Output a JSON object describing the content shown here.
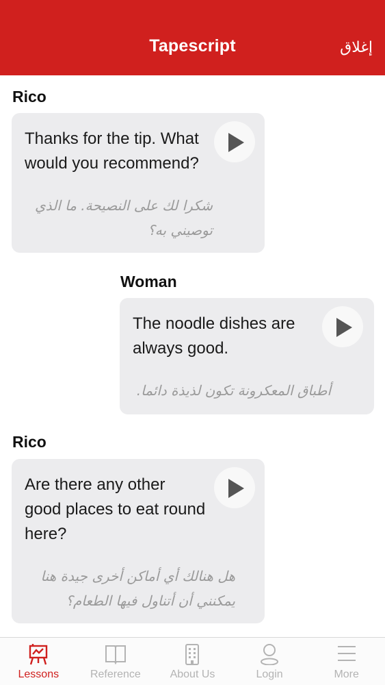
{
  "header": {
    "title": "Tapescript",
    "close_label": "إغلاق"
  },
  "dialogue": [
    {
      "speaker": "Rico",
      "en_lines": [
        "Thanks for the tip. What",
        "would you recommend?"
      ],
      "ar_lines": [
        "شكرا لك على النصيحة. ما الذي",
        "توصيني به؟"
      ]
    },
    {
      "speaker": "Woman",
      "en_lines": [
        "The noodle dishes are",
        "always good."
      ],
      "ar_lines": [
        "أطباق المعكرونة تكون لذيذة دائما."
      ]
    },
    {
      "speaker": "Rico",
      "en_lines": [
        "Are there any other",
        "good places to eat round",
        "here?"
      ],
      "ar_lines": [
        "هل هنالك أي أماكن أخرى جيدة هنا",
        "يمكنني أن أتناول فيها الطعام؟"
      ]
    }
  ],
  "tabbar": {
    "active_color": "#d0201e",
    "inactive_color": "#b3b3b3",
    "tabs": [
      {
        "label": "Lessons",
        "icon": "lessons-board-icon"
      },
      {
        "label": "Reference",
        "icon": "book-icon"
      },
      {
        "label": "About Us",
        "icon": "building-icon"
      },
      {
        "label": "Login",
        "icon": "user-icon"
      },
      {
        "label": "More",
        "icon": "menu-icon"
      }
    ]
  },
  "colors": {
    "header_bg": "#d0201e",
    "bubble_bg": "#ececee",
    "arabic_text": "#9a9a9a"
  }
}
